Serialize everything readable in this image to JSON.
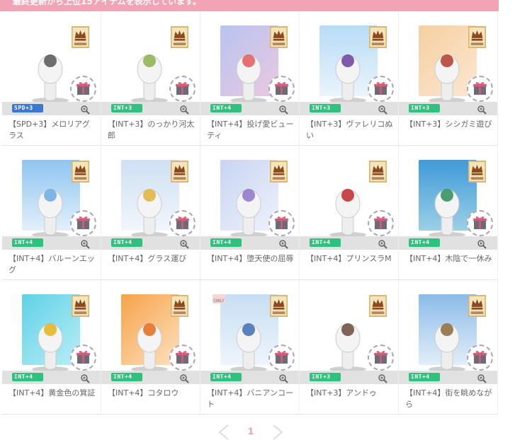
{
  "banner": {
    "text": "最終更新から上位15アイテムを表示しています。"
  },
  "icons": {
    "corner": "choco-crown-icon",
    "gift": "gift-icon",
    "zoom": "magnifier-plus-icon"
  },
  "colors": {
    "banner": "#f2a3b4",
    "int_badge": "#2ec27e",
    "spd_badge": "#3a78d8",
    "page_active": "#f190a8"
  },
  "items": [
    {
      "name": "【SPD+3】メロリアグラス",
      "stat": "SPD+3"
    },
    {
      "name": "【INT+3】のっかり河太郎",
      "stat": "INT+3"
    },
    {
      "name": "【INT+4】投げ愛ビューティ",
      "stat": "INT+4"
    },
    {
      "name": "【INT+3】ヴァレリコぬい",
      "stat": "INT+3"
    },
    {
      "name": "【INT+3】シシガミ遊び",
      "stat": "INT+3"
    },
    {
      "name": "【INT+4】バルーンエッグ",
      "stat": "INT+4"
    },
    {
      "name": "【INT+4】グラス運び",
      "stat": "INT+4"
    },
    {
      "name": "【INT+4】堕天使の屈辱",
      "stat": "INT+4"
    },
    {
      "name": "【INT+4】プリンスラM",
      "stat": "INT+4"
    },
    {
      "name": "【INT+4】木陰で一休み",
      "stat": "INT+4"
    },
    {
      "name": "【INT+4】黄金色の箕証",
      "stat": "INT+4"
    },
    {
      "name": "【INT+4】コタロウ",
      "stat": "INT+4"
    },
    {
      "name": "【INT+4】バニアンコート",
      "stat": "INT+4",
      "tag": "ONLY"
    },
    {
      "name": "【INT+3】アンドゥ",
      "stat": "INT+3"
    },
    {
      "name": "【INT+4】街を眺めながら",
      "stat": "INT+4"
    }
  ],
  "pagination": {
    "current": "1"
  }
}
